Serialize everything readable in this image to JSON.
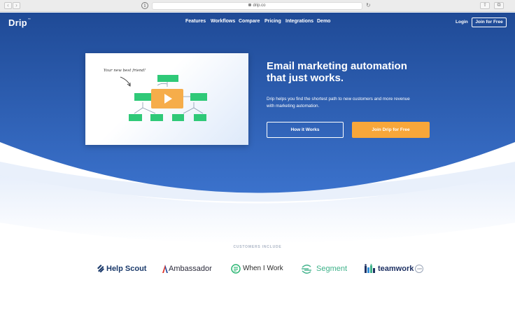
{
  "browser": {
    "url": "drip.co",
    "back_glyph": "‹",
    "forward_glyph": "›",
    "info_glyph": "i",
    "reload_glyph": "↻",
    "share_glyph": "⇧",
    "tabs_glyph": "⧉"
  },
  "nav": {
    "logo": "Drip",
    "logo_tm": "™",
    "links": [
      "Features",
      "Workflows",
      "Compare",
      "Pricing",
      "Integrations",
      "Demo"
    ],
    "login": "Login",
    "join": "Join for Free"
  },
  "video": {
    "handwritten_note": "Your new best friend!"
  },
  "hero": {
    "headline_line1": "Email marketing automation",
    "headline_line2": "that just works.",
    "subtext_line1": "Drip helps you find the shortest path to new customers and more revenue",
    "subtext_line2": "with marketing automation.",
    "how_button": "How it Works",
    "join_button": "Join Drip for Free"
  },
  "customers": {
    "label": "CUSTOMERS INCLUDE",
    "logos": [
      {
        "name": "HelpScout",
        "text": "Help Scout",
        "color": "#1b3a6b"
      },
      {
        "name": "Ambassador",
        "text": "Ambassador",
        "color": "#2a2a3a"
      },
      {
        "name": "WhenIWork",
        "text": "When I Work",
        "color": "#2a2a2a"
      },
      {
        "name": "Segment",
        "text": "Segment",
        "color": "#3fb28a"
      },
      {
        "name": "teamwork",
        "text": "teamwork",
        "color": "#1e3163",
        "suffix": ".com"
      }
    ]
  },
  "colors": {
    "hero_dark": "#1f4a96",
    "hero_light": "#3b72cc",
    "accent_orange": "#f8a73a",
    "node_green": "#2fc978",
    "play_orange": "#f6ad4a"
  }
}
